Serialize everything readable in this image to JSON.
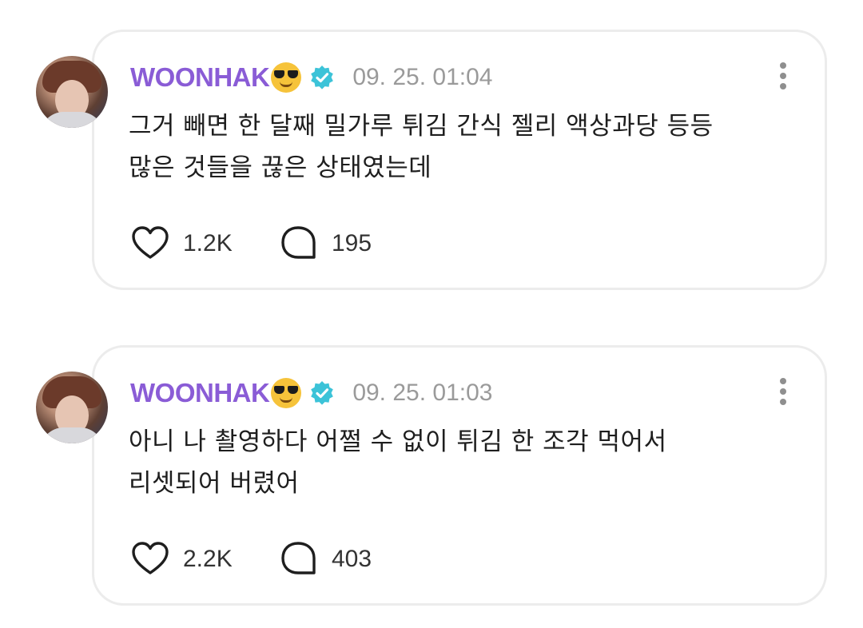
{
  "posts": [
    {
      "author": "WOONHAK",
      "author_emoji": "sunglasses-emoji",
      "verified_icon": "verified-check-icon",
      "timestamp": "09. 25. 01:04",
      "text_lines": [
        "그거 빼면 한 달째 밀가루 튀김 간식 젤리 액상과당 등등",
        "많은 것들을 끊은 상태였는데"
      ],
      "likes": "1.2K",
      "replies": "195"
    },
    {
      "author": "WOONHAK",
      "author_emoji": "sunglasses-emoji",
      "verified_icon": "verified-check-icon",
      "timestamp": "09. 25. 01:03",
      "text_lines": [
        "아니 나 촬영하다 어쩔 수 없이 튀김 한 조각 먹어서",
        "리셋되어 버렸어"
      ],
      "likes": "2.2K",
      "replies": "403"
    }
  ],
  "colors": {
    "author": "#8a5cd6",
    "verified": "#3cc3d8",
    "timestamp": "#9a9a9a",
    "card_border": "#ececec"
  }
}
